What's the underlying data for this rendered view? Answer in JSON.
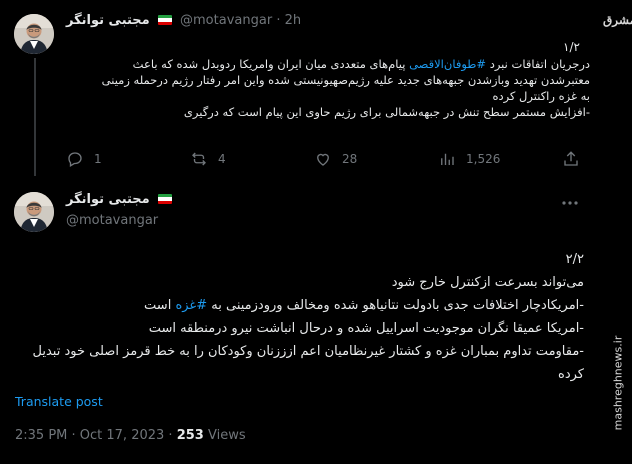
{
  "tweet1": {
    "display_name": "مجتبی توانگر",
    "handle": "@motavangar",
    "time": "2h",
    "separator": "·",
    "thread_count": "۱/۲",
    "lines": [
      {
        "prefix": "درجریان اتفاقات نبرد ",
        "hashtag": "#طوفان‌الاقصی",
        "suffix": " پیام‌های متعددی میان ایران وامریکا ردوبدل شده که باعث"
      },
      {
        "prefix": "معتبرشدن تهدید وبازشدن جبهه‌های جدید علیه رژیم‌صهیونیستی شده واین امر رفتار رژیم درحمله زمینی",
        "hashtag": "",
        "suffix": ""
      },
      {
        "prefix": "به غزه راکنترل کرده",
        "hashtag": "",
        "suffix": ""
      },
      {
        "prefix": "-افزایش مستمر سطح تنش در جبهه‌شمالی برای رژیم حاوی این پیام است که درگیری",
        "hashtag": "",
        "suffix": ""
      }
    ],
    "actions": {
      "replies": "1",
      "reposts": "4",
      "likes": "28",
      "views": "1,526"
    }
  },
  "tweet2": {
    "display_name": "مجتبی توانگر",
    "handle": "@motavangar",
    "lines": [
      {
        "prefix": "۲/۲",
        "hashtag": "",
        "suffix": ""
      },
      {
        "prefix": "می‌تواند بسرعت ازکنترل خارج شود",
        "hashtag": "",
        "suffix": ""
      },
      {
        "prefix": "-امریکادچار اختلافات جدی بادولت نتانیاهو شده ومخالف ورودزمینی به ",
        "hashtag": "#غزه",
        "suffix": " است"
      },
      {
        "prefix": "-امریکا عمیقا نگران موجودیت اسراییل شده و درحال انباشت نیرو درمنطقه است",
        "hashtag": "",
        "suffix": ""
      },
      {
        "prefix": "-مقاومت تداوم بمباران غزه و کشتار غیرنظامیان اعم ازززنان وکودکان را به خط قرمز اصلی خود تبدیل",
        "hashtag": "",
        "suffix": ""
      },
      {
        "prefix": "کرده",
        "hashtag": "",
        "suffix": ""
      }
    ],
    "translate_label": "Translate post",
    "timestamp": "2:35 PM · Oct 17, 2023",
    "dot": "·",
    "views_count": "253",
    "views_label": "Views"
  },
  "watermark": {
    "logo": "مشرق",
    "url": "mashreghnews.ir"
  },
  "icons": {
    "reply": "reply-icon",
    "repost": "repost-icon",
    "like": "heart-icon",
    "views": "views-icon",
    "share": "share-icon",
    "more": "more-icon"
  },
  "colors": {
    "background": "#000000",
    "text": "#e7e9ea",
    "muted": "#71767b",
    "link": "#1d9bf0",
    "flag_green": "#239f40",
    "flag_white": "#ffffff",
    "flag_red": "#da0000"
  }
}
